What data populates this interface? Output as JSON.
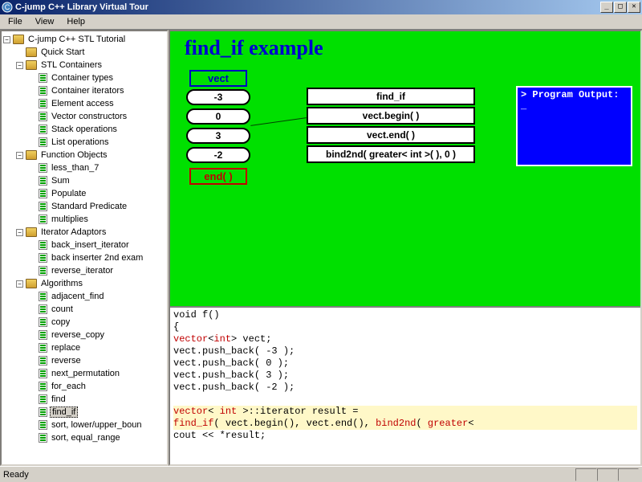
{
  "window": {
    "title": "C-jump C++ Library Virtual Tour"
  },
  "menu": {
    "file": "File",
    "view": "View",
    "help": "Help"
  },
  "tree": {
    "root": "C-jump C++ STL Tutorial",
    "quick_start": "Quick Start",
    "stl_containers": "STL Containers",
    "container_types": "Container types",
    "container_iterators": "Container iterators",
    "element_access": "Element access",
    "vector_constructors": "Vector constructors",
    "stack_operations": "Stack operations",
    "list_operations": "List operations",
    "function_objects": "Function Objects",
    "less_than_7": "less_than_7",
    "sum": "Sum",
    "populate": "Populate",
    "standard_predicate": "Standard Predicate",
    "multiplies": "multiplies",
    "iterator_adaptors": "Iterator Adaptors",
    "back_insert_iterator": "back_insert_iterator",
    "back_inserter_2nd": "back inserter 2nd exam",
    "reverse_iterator": "reverse_iterator",
    "algorithms": "Algorithms",
    "adjacent_find": "adjacent_find",
    "count": "count",
    "copy": "copy",
    "reverse_copy": "reverse_copy",
    "replace": "replace",
    "reverse": "reverse",
    "next_permutation": "next_permutation",
    "for_each": "for_each",
    "find": "find",
    "find_if": "find_if",
    "sort_lower_upper": "sort, lower/upper_boun",
    "sort_equal_range": "sort, equal_range"
  },
  "diagram": {
    "title": "find_if example",
    "vect_label": "vect",
    "vect_items": [
      "-3",
      "0",
      "3",
      "-2"
    ],
    "end_label": "end( )",
    "calls": [
      "find_if",
      "vect.begin( )",
      "vect.end( )",
      "bind2nd( greater< int >( ), 0 )"
    ],
    "output_header": "> Program Output:",
    "output_cursor": "_"
  },
  "code": {
    "l1": "void f()",
    "l2": "{",
    "l3a": "        ",
    "l3_kw": "vector",
    "l3b": "<",
    "l3_kw2": "int",
    "l3c": "> vect;",
    "l4": "        vect.push_back( -3 );",
    "l5": "        vect.push_back( 0 );",
    "l6": "        vect.push_back( 3 );",
    "l7": "        vect.push_back( -2 );",
    "l8": "",
    "l9a": "        ",
    "l9_kw": "vector",
    "l9b": "< ",
    "l9_kw2": "int",
    "l9c": " >::iterator result =",
    "l10a": "                ",
    "l10_kw": "find_if",
    "l10b": "( vect.begin(), vect.end(), ",
    "l10_kw2": "bind2nd",
    "l10c": "( ",
    "l10_kw3": "greater",
    "l10d": "<",
    "l11": "        cout << *result;"
  },
  "status": {
    "ready": "Ready"
  }
}
